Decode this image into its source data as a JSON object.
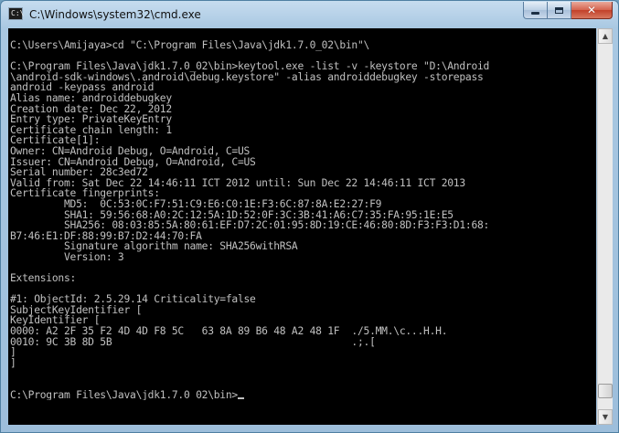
{
  "window": {
    "title": "C:\\Windows\\system32\\cmd.exe",
    "app_icon_text": "C:\\",
    "icons": {
      "app": "cmd-terminal-icon",
      "minimize": "minimize-icon",
      "maximize": "maximize-icon",
      "close": "close-icon"
    },
    "close_glyph": "✕"
  },
  "console": {
    "text": "C:\\Users\\Amijaya>cd \"C:\\Program Files\\Java\\jdk1.7.0_02\\bin\"\\\n\nC:\\Program Files\\Java\\jdk1.7.0_02\\bin>keytool.exe -list -v -keystore \"D:\\Android\n\\android-sdk-windows\\.android\\debug.keystore\" -alias androiddebugkey -storepass\nandroid -keypass android\nAlias name: androiddebugkey\nCreation date: Dec 22, 2012\nEntry type: PrivateKeyEntry\nCertificate chain length: 1\nCertificate[1]:\nOwner: CN=Android Debug, O=Android, C=US\nIssuer: CN=Android Debug, O=Android, C=US\nSerial number: 28c3ed72\nValid from: Sat Dec 22 14:46:11 ICT 2012 until: Sun Dec 22 14:46:11 ICT 2013\nCertificate fingerprints:\n         MD5:  0C:53:0C:F7:51:C9:E6:C0:1E:F3:6C:87:8A:E2:27:F9\n         SHA1: 59:56:68:A0:2C:12:5A:1D:52:0F:3C:3B:41:A6:C7:35:FA:95:1E:E5\n         SHA256: 08:03:85:5A:80:61:EF:D7:2C:01:95:8D:19:CE:46:80:8D:F3:F3:D1:68:\nB7:46:E1:DF:88:99:B7:D2:44:70:FA\n         Signature algorithm name: SHA256withRSA\n         Version: 3\n\nExtensions:\n\n#1: ObjectId: 2.5.29.14 Criticality=false\nSubjectKeyIdentifier [\nKeyIdentifier [\n0000: A2 2F 35 F2 4D 4D F8 5C   63 8A 89 B6 48 A2 48 1F  ./5.MM.\\c...H.H.\n0010: 9C 3B 8D 5B                                        .;.[\n]\n]\n\n\nC:\\Program Files\\Java\\jdk1.7.0_02\\bin>"
  },
  "scrollbar": {
    "up_glyph": "▲",
    "down_glyph": "▼",
    "position_fraction": 0.97
  }
}
